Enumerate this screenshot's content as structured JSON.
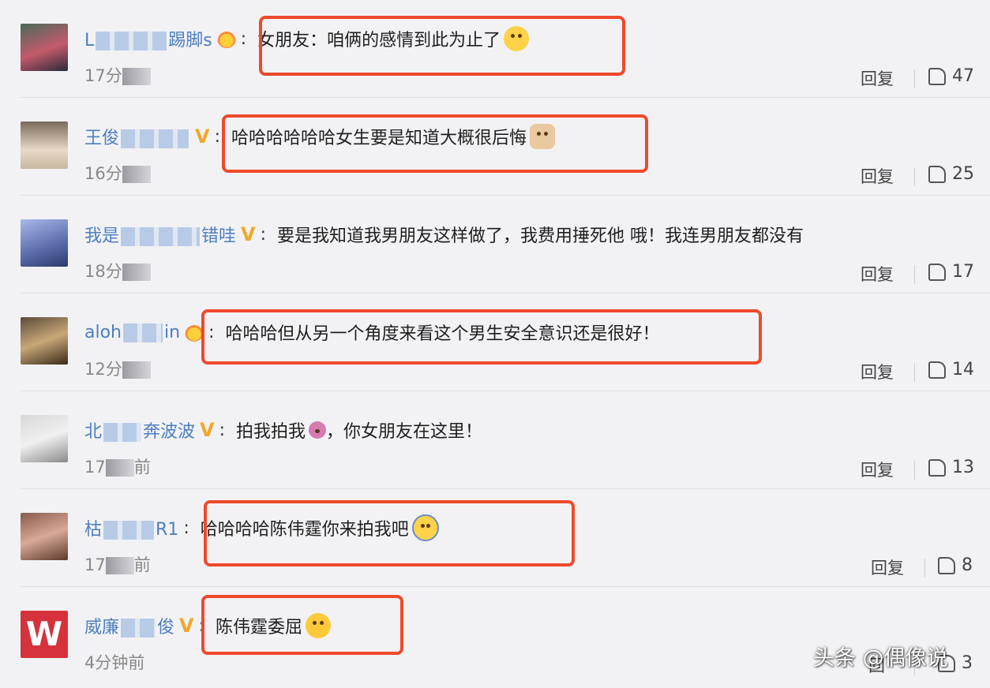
{
  "comments": [
    {
      "name_start": "L",
      "name_end": "踢脚s",
      "badge": "crown",
      "text": "女朋友：咱俩的感情到此为止了",
      "emoji": "blush-smile-icon",
      "time": "17分",
      "reply": "回复",
      "likes": "47"
    },
    {
      "name_start": "王俊",
      "name_end": "",
      "badge": "V",
      "text": "哈哈哈哈哈哈女生要是知道大概很后悔",
      "emoji": "cat-face-icon",
      "time": "16分",
      "reply": "回复",
      "likes": "25"
    },
    {
      "name_start": "我是",
      "name_end": "错哇",
      "badge": "V",
      "text": "要是我知道我男朋友这样做了，我费用捶死他 哦！我连男朋友都没有",
      "emoji": "",
      "time": "18分",
      "reply": "回复",
      "likes": "17"
    },
    {
      "name_start": "aloh",
      "name_end": "in",
      "badge": "crown",
      "text": "哈哈哈但从另一个角度来看这个男生安全意识还是很好！",
      "emoji": "",
      "time": "12分",
      "reply": "回复",
      "likes": "14"
    },
    {
      "name_start": "北",
      "name_end": "奔波波",
      "badge": "V",
      "text": "拍我拍我",
      "text_after": "，你女朋友在这里！",
      "emoji": "raising-hand-icon",
      "time": "17",
      "time_end": "前",
      "reply": "回复",
      "likes": "13"
    },
    {
      "name_start": "枯",
      "name_end": "R1",
      "badge": "",
      "text": "哈哈哈哈陈伟霆你来拍我吧",
      "emoji": "laugh-cry-icon",
      "time": "17",
      "time_end": "前",
      "reply": "回复",
      "likes": "8"
    },
    {
      "name_start": "威廉",
      "name_end": "俊",
      "badge": "V",
      "text": "陈伟霆委屈",
      "emoji": "big-grin-icon",
      "time": "4分钟前",
      "reply": "回",
      "likes": "3"
    }
  ],
  "watermark": "头条 @偶像说",
  "colors": {
    "name": "#4d7fc0",
    "highlight": "#ee4a2c",
    "vbadge": "#f0a82a"
  }
}
